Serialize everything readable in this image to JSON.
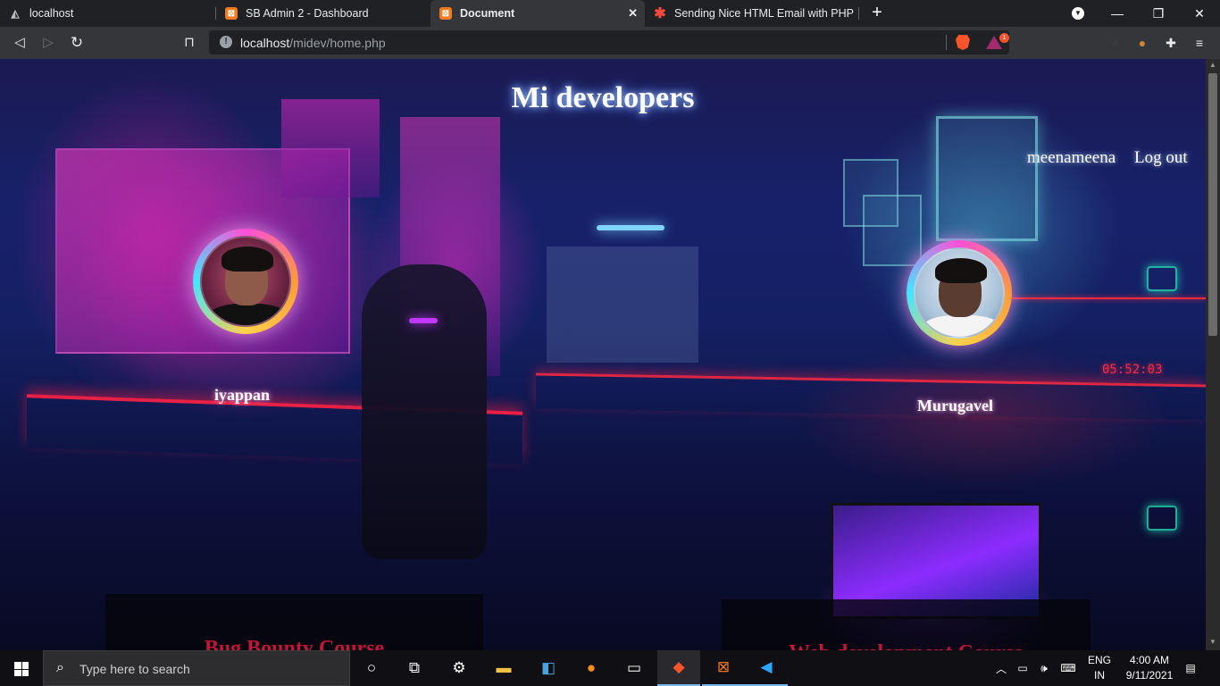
{
  "browser": {
    "tabs": [
      {
        "title": "localhost",
        "favicon": "xampp-stack-icon",
        "active": false
      },
      {
        "title": "SB Admin 2 - Dashboard",
        "favicon": "xampp-icon",
        "active": false
      },
      {
        "title": "Document",
        "favicon": "xampp-icon",
        "active": true
      },
      {
        "title": "Sending Nice HTML Email with PHP | C",
        "favicon": "asterisk-icon",
        "active": false
      }
    ],
    "address": {
      "host": "localhost",
      "path": "/midev/home.php"
    },
    "rewards_badge": "1"
  },
  "page": {
    "site_title": "Mi developers",
    "nav": {
      "username": "meenameena",
      "logout": "Log out"
    },
    "members": [
      {
        "name": "iyappan"
      },
      {
        "name": "Murugavel"
      }
    ],
    "courses": [
      {
        "title": "Bug Bounty Course"
      },
      {
        "title": "Web development Course"
      }
    ],
    "accent_color": "#c2163a"
  },
  "taskbar": {
    "search_placeholder": "Type here to search",
    "language": {
      "line1": "ENG",
      "line2": "IN"
    },
    "time": "4:00 AM",
    "date": "9/11/2021"
  }
}
